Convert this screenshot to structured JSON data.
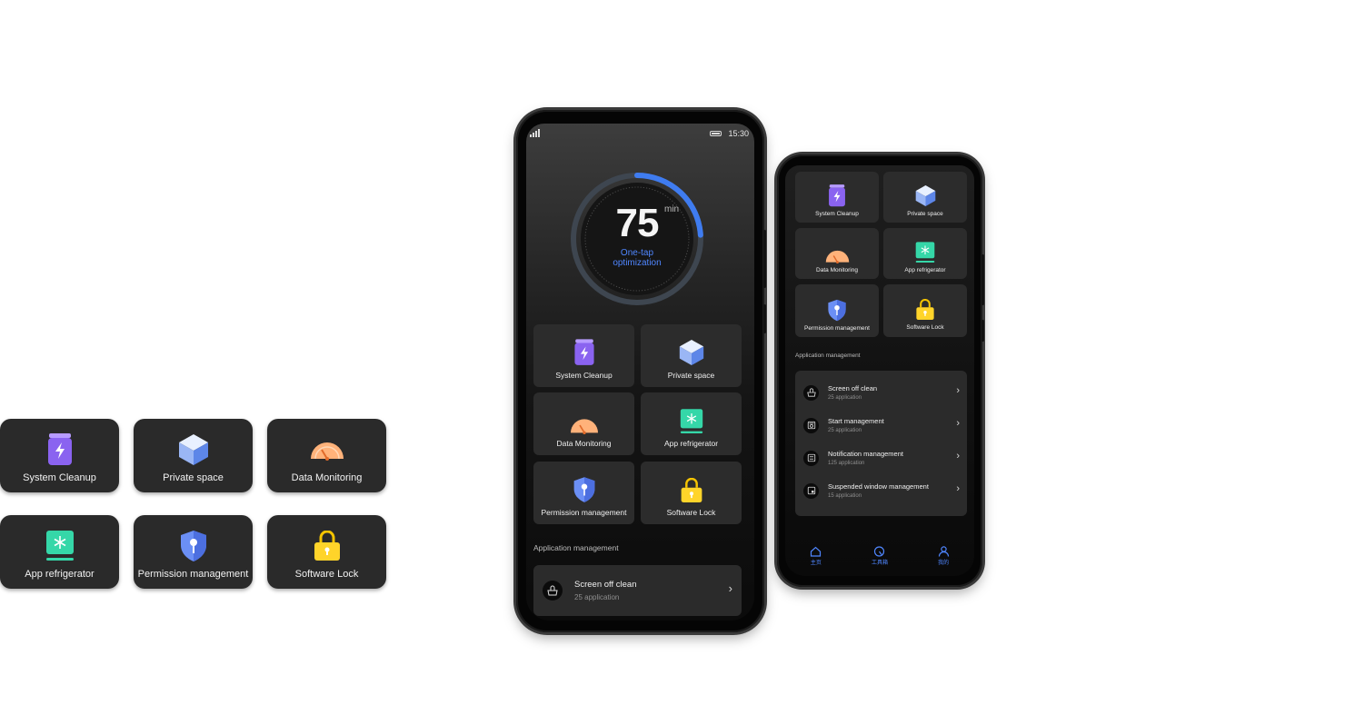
{
  "loose_cards": [
    {
      "label": "System Cleanup",
      "icon": "trash-bin-icon"
    },
    {
      "label": "Private space",
      "icon": "cube-icon"
    },
    {
      "label": "Data Monitoring",
      "icon": "speedometer-icon"
    },
    {
      "label": "App refrigerator",
      "icon": "snowflake-icon"
    },
    {
      "label": "Permission management",
      "icon": "shield-key-icon"
    },
    {
      "label": "Software Lock",
      "icon": "padlock-icon"
    }
  ],
  "big_phone": {
    "status": {
      "time": "15:30"
    },
    "gauge": {
      "value": "75",
      "unit": "min",
      "caption_line1": "One-tap",
      "caption_line2": "optimization",
      "progress_fraction": 0.24
    },
    "tiles": [
      {
        "label": "System Cleanup",
        "icon": "trash-bin-icon"
      },
      {
        "label": "Private space",
        "icon": "cube-icon"
      },
      {
        "label": "Data Monitoring",
        "icon": "speedometer-icon"
      },
      {
        "label": "App refrigerator",
        "icon": "snowflake-icon"
      },
      {
        "label": "Permission management",
        "icon": "shield-key-icon"
      },
      {
        "label": "Software Lock",
        "icon": "padlock-icon"
      }
    ],
    "section_title": "Application management",
    "rows": [
      {
        "title": "Screen off clean",
        "subtitle": "25 application",
        "icon": "basket-icon"
      }
    ]
  },
  "small_phone": {
    "tiles": [
      {
        "label": "System Cleanup",
        "icon": "trash-bin-icon"
      },
      {
        "label": "Private space",
        "icon": "cube-icon"
      },
      {
        "label": "Data Monitoring",
        "icon": "speedometer-icon"
      },
      {
        "label": "App refrigerator",
        "icon": "snowflake-icon"
      },
      {
        "label": "Permission management",
        "icon": "shield-key-icon"
      },
      {
        "label": "Software Lock",
        "icon": "padlock-icon"
      }
    ],
    "section_title": "Application management",
    "rows": [
      {
        "title": "Screen off clean",
        "subtitle": "25 application",
        "icon": "basket-icon"
      },
      {
        "title": "Start management",
        "subtitle": "25 application",
        "icon": "startup-icon"
      },
      {
        "title": "Notification management",
        "subtitle": "125 application",
        "icon": "notification-icon"
      },
      {
        "title": "Suspended window management",
        "subtitle": "15 application",
        "icon": "floating-window-icon"
      }
    ],
    "tabs": [
      {
        "label": "主页",
        "icon": "home-icon"
      },
      {
        "label": "工具箱",
        "icon": "toolbox-icon"
      },
      {
        "label": "我的",
        "icon": "profile-icon"
      }
    ]
  },
  "colors": {
    "accent": "#4f86ff",
    "tile_bg": "#2c2c2c",
    "card_bg": "#2a2a2a"
  }
}
